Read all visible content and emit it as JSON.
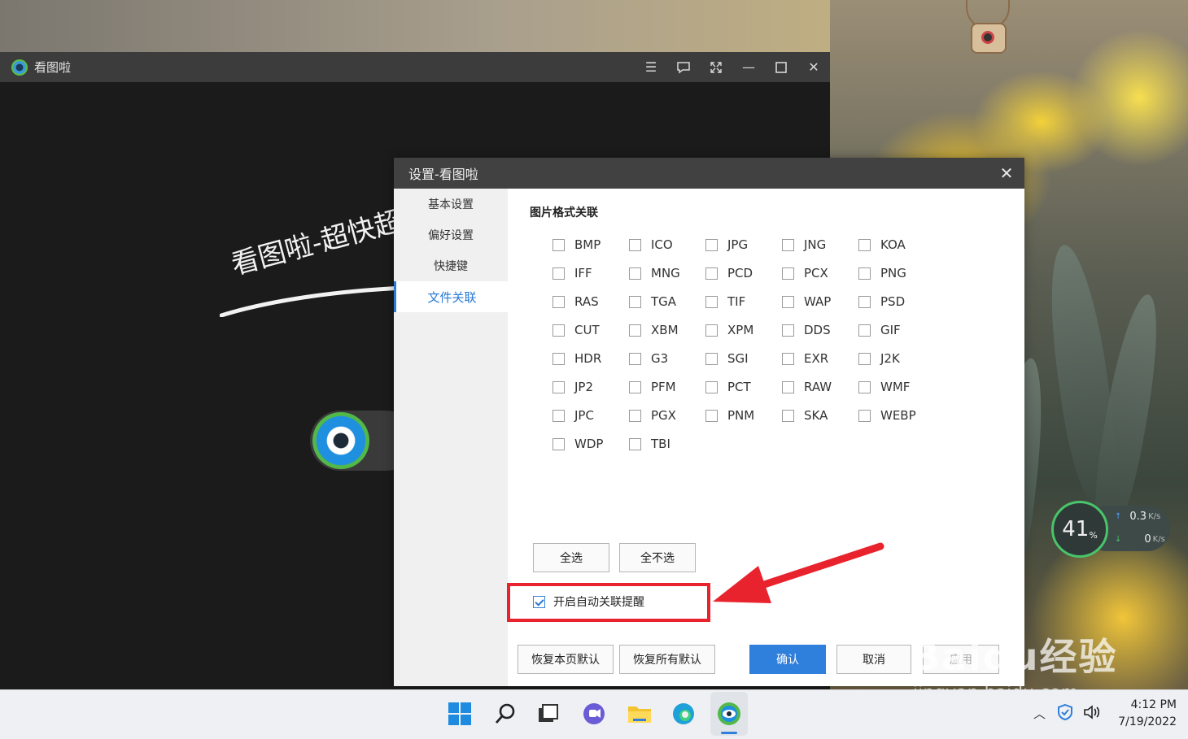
{
  "viewer": {
    "title": "看图啦",
    "slogan": "看图啦-超快超"
  },
  "dialog": {
    "title": "设置-看图啦",
    "sidebar": [
      "基本设置",
      "偏好设置",
      "快捷键",
      "文件关联"
    ],
    "active_index": 3,
    "section_title": "图片格式关联",
    "formats": [
      [
        "BMP",
        "ICO",
        "JPG",
        "JNG",
        "KOA"
      ],
      [
        "IFF",
        "MNG",
        "PCD",
        "PCX",
        "PNG"
      ],
      [
        "RAS",
        "TGA",
        "TIF",
        "WAP",
        "PSD"
      ],
      [
        "CUT",
        "XBM",
        "XPM",
        "DDS",
        "GIF"
      ],
      [
        "HDR",
        "G3",
        "SGI",
        "EXR",
        "J2K"
      ],
      [
        "JP2",
        "PFM",
        "PCT",
        "RAW",
        "WMF"
      ],
      [
        "JPC",
        "PGX",
        "PNM",
        "SKA",
        "WEBP"
      ],
      [
        "WDP",
        "TBI"
      ]
    ],
    "select_all": "全选",
    "select_none": "全不选",
    "auto_assoc_label": "开启自动关联提醒",
    "auto_assoc_checked": true,
    "restore_page": "恢复本页默认",
    "restore_all": "恢复所有默认",
    "confirm": "确认",
    "cancel": "取消",
    "apply_partial": "应用"
  },
  "speed_widget": {
    "percent": "41",
    "percent_symbol": "%",
    "upload": "0.3",
    "download": "0",
    "unit": "K/s"
  },
  "watermark": {
    "brand": "Baidu经验",
    "url": "jingyan.baidu.com"
  },
  "taskbar": {
    "time": "4:12 PM",
    "date": "7/19/2022"
  },
  "colors": {
    "accent": "#2f7fdc",
    "highlight_box": "#e8232d",
    "dialog_title_bg": "#414141"
  }
}
